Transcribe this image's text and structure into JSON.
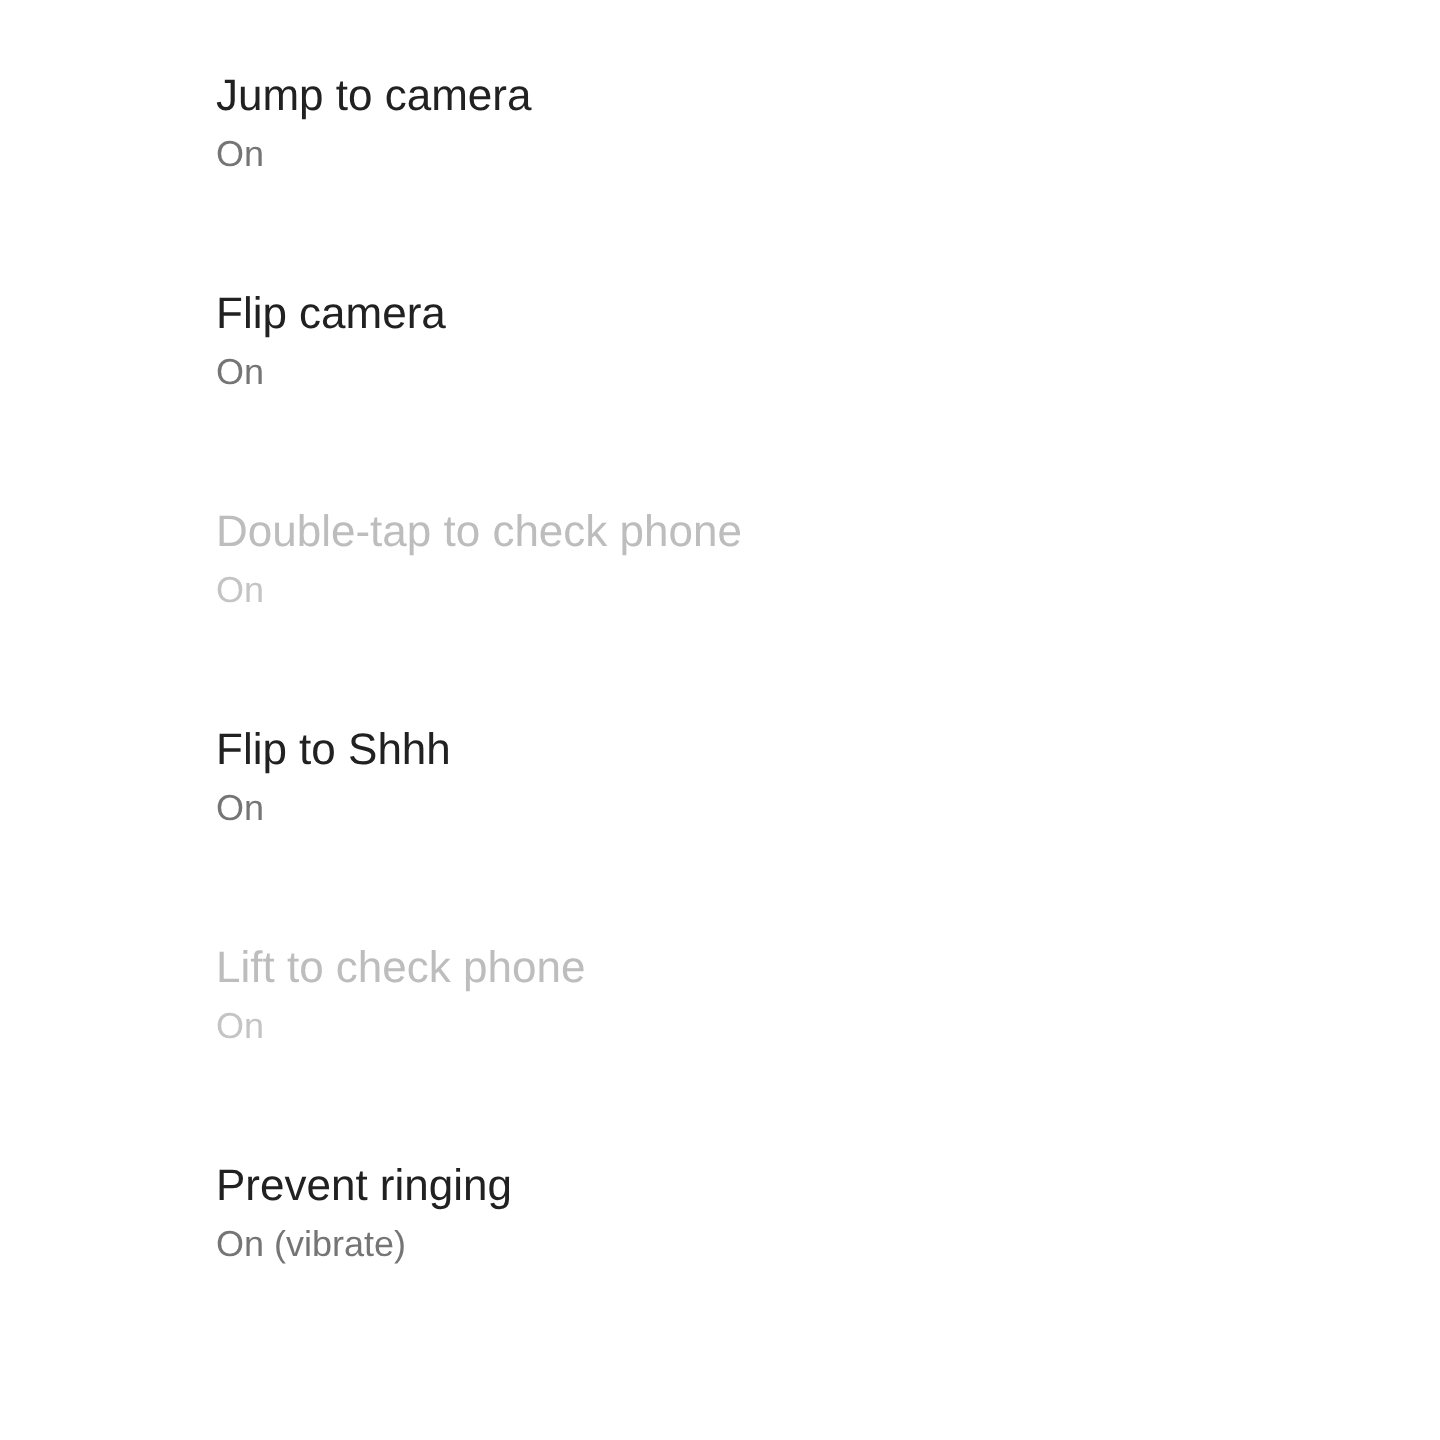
{
  "settings": [
    {
      "title": "Jump to camera",
      "summary": "On",
      "disabled": false
    },
    {
      "title": "Flip camera",
      "summary": "On",
      "disabled": false
    },
    {
      "title": "Double-tap to check phone",
      "summary": "On",
      "disabled": true
    },
    {
      "title": "Flip to Shhh",
      "summary": "On",
      "disabled": false
    },
    {
      "title": "Lift to check phone",
      "summary": "On",
      "disabled": true
    },
    {
      "title": "Prevent ringing",
      "summary": "On (vibrate)",
      "disabled": false
    }
  ]
}
